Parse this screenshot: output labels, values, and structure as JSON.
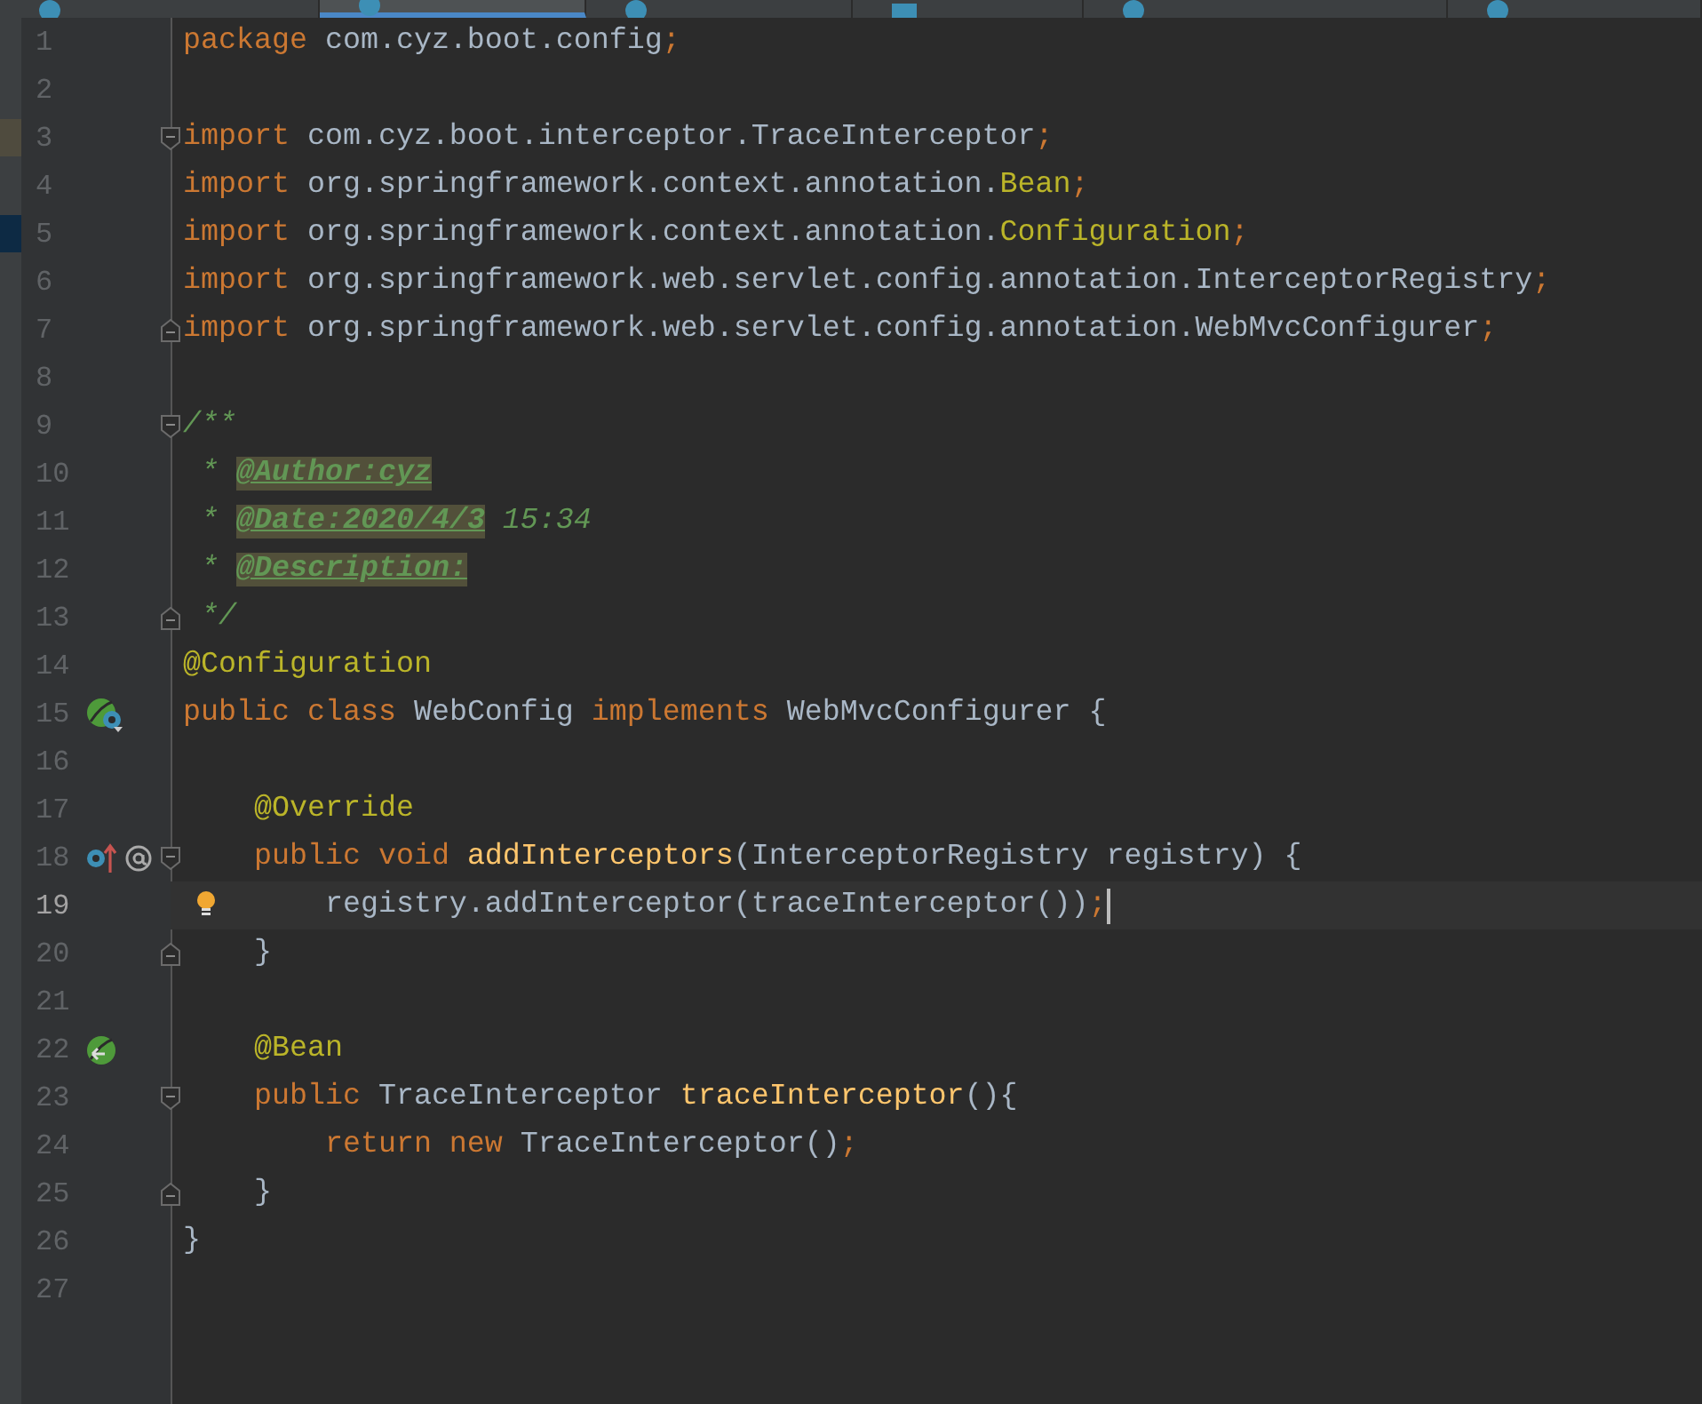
{
  "tabs": [
    {
      "kind": "class",
      "selected": false
    },
    {
      "kind": "class",
      "selected": true
    },
    {
      "kind": "class",
      "selected": false
    },
    {
      "kind": "markdown",
      "selected": false
    },
    {
      "kind": "class",
      "selected": false
    },
    {
      "kind": "class",
      "selected": false
    }
  ],
  "lines": [
    {
      "number": "1",
      "tokens": [
        {
          "kind": "keyword",
          "text": "package "
        },
        {
          "kind": "plain",
          "text": "com.cyz.boot.config"
        },
        {
          "kind": "keyword",
          "text": ";"
        }
      ]
    },
    {
      "number": "2"
    },
    {
      "number": "3",
      "fold": {
        "kind": "start"
      },
      "change_marker": {
        "color": "#4f4b3e"
      },
      "tokens": [
        {
          "kind": "keyword",
          "text": "import "
        },
        {
          "kind": "plain",
          "text": "com.cyz.boot.interceptor.TraceInterceptor"
        },
        {
          "kind": "keyword",
          "text": ";"
        }
      ]
    },
    {
      "number": "4",
      "tokens": [
        {
          "kind": "keyword",
          "text": "import "
        },
        {
          "kind": "plain",
          "text": "org.springframework.context.annotation."
        },
        {
          "kind": "annotation",
          "text": "Bean"
        },
        {
          "kind": "keyword",
          "text": ";"
        }
      ]
    },
    {
      "number": "5",
      "change_marker": {
        "color": "#0d2a44"
      },
      "tokens": [
        {
          "kind": "keyword",
          "text": "import "
        },
        {
          "kind": "plain",
          "text": "org.springframework.context.annotation."
        },
        {
          "kind": "annotation",
          "text": "Configuration"
        },
        {
          "kind": "keyword",
          "text": ";"
        }
      ]
    },
    {
      "number": "6",
      "tokens": [
        {
          "kind": "keyword",
          "text": "import "
        },
        {
          "kind": "plain",
          "text": "org.springframework.web.servlet.config.annotation.InterceptorRegistry"
        },
        {
          "kind": "keyword",
          "text": ";"
        }
      ]
    },
    {
      "number": "7",
      "fold": {
        "kind": "end"
      },
      "tokens": [
        {
          "kind": "keyword",
          "text": "import "
        },
        {
          "kind": "plain",
          "text": "org.springframework.web.servlet.config.annotation.WebMvcConfigurer"
        },
        {
          "kind": "keyword",
          "text": ";"
        }
      ]
    },
    {
      "number": "8"
    },
    {
      "number": "9",
      "fold": {
        "kind": "start"
      },
      "tokens": [
        {
          "kind": "doc",
          "text": "/**"
        }
      ]
    },
    {
      "number": "10",
      "tokens": [
        {
          "kind": "doc",
          "text": " * "
        },
        {
          "kind": "doctag",
          "text": "@Author:cyz"
        }
      ]
    },
    {
      "number": "11",
      "tokens": [
        {
          "kind": "doc",
          "text": " * "
        },
        {
          "kind": "doctag",
          "text": "@Date:2020/4/3"
        },
        {
          "kind": "doc",
          "text": " 15:34"
        }
      ]
    },
    {
      "number": "12",
      "tokens": [
        {
          "kind": "doc",
          "text": " * "
        },
        {
          "kind": "doctag",
          "text": "@Description:"
        }
      ]
    },
    {
      "number": "13",
      "fold": {
        "kind": "end"
      },
      "tokens": [
        {
          "kind": "doc",
          "text": " */"
        }
      ]
    },
    {
      "number": "14",
      "tokens": [
        {
          "kind": "annotation",
          "text": "@Configuration"
        }
      ]
    },
    {
      "number": "15",
      "gutter": [
        {
          "kind": "bean-class"
        }
      ],
      "tokens": [
        {
          "kind": "keyword",
          "text": "public class "
        },
        {
          "kind": "plain",
          "text": "WebConfig "
        },
        {
          "kind": "keyword",
          "text": "implements "
        },
        {
          "kind": "plain",
          "text": "WebMvcConfigurer {"
        }
      ]
    },
    {
      "number": "16"
    },
    {
      "number": "17",
      "tokens": [
        {
          "kind": "annotation",
          "text": "    @Override"
        }
      ]
    },
    {
      "number": "18",
      "fold": {
        "kind": "start"
      },
      "gutter": [
        {
          "kind": "override"
        },
        {
          "kind": "at"
        }
      ],
      "tokens": [
        {
          "kind": "keyword",
          "text": "    public void "
        },
        {
          "kind": "method",
          "text": "addInterceptors"
        },
        {
          "kind": "plain",
          "text": "(InterceptorRegistry registry) {"
        }
      ]
    },
    {
      "number": "19",
      "current": true,
      "bulb": true,
      "tokens": [
        {
          "kind": "plain",
          "text": "        registry.addInterceptor(traceInterceptor())"
        },
        {
          "kind": "keyword",
          "text": ";"
        }
      ]
    },
    {
      "number": "20",
      "fold": {
        "kind": "end"
      },
      "tokens": [
        {
          "kind": "plain",
          "text": "    }"
        }
      ]
    },
    {
      "number": "21"
    },
    {
      "number": "22",
      "gutter": [
        {
          "kind": "bean-method"
        }
      ],
      "tokens": [
        {
          "kind": "annotation",
          "text": "    @Bean"
        }
      ]
    },
    {
      "number": "23",
      "fold": {
        "kind": "start"
      },
      "tokens": [
        {
          "kind": "keyword",
          "text": "    public "
        },
        {
          "kind": "plain",
          "text": "TraceInterceptor "
        },
        {
          "kind": "method",
          "text": "traceInterceptor"
        },
        {
          "kind": "plain",
          "text": "(){"
        }
      ]
    },
    {
      "number": "24",
      "tokens": [
        {
          "kind": "keyword",
          "text": "        return new "
        },
        {
          "kind": "plain",
          "text": "TraceInterceptor()"
        },
        {
          "kind": "keyword",
          "text": ";"
        }
      ]
    },
    {
      "number": "25",
      "fold": {
        "kind": "end"
      },
      "tokens": [
        {
          "kind": "plain",
          "text": "    }"
        }
      ]
    },
    {
      "number": "26",
      "tokens": [
        {
          "kind": "plain",
          "text": "}"
        }
      ]
    },
    {
      "number": "27"
    }
  ]
}
